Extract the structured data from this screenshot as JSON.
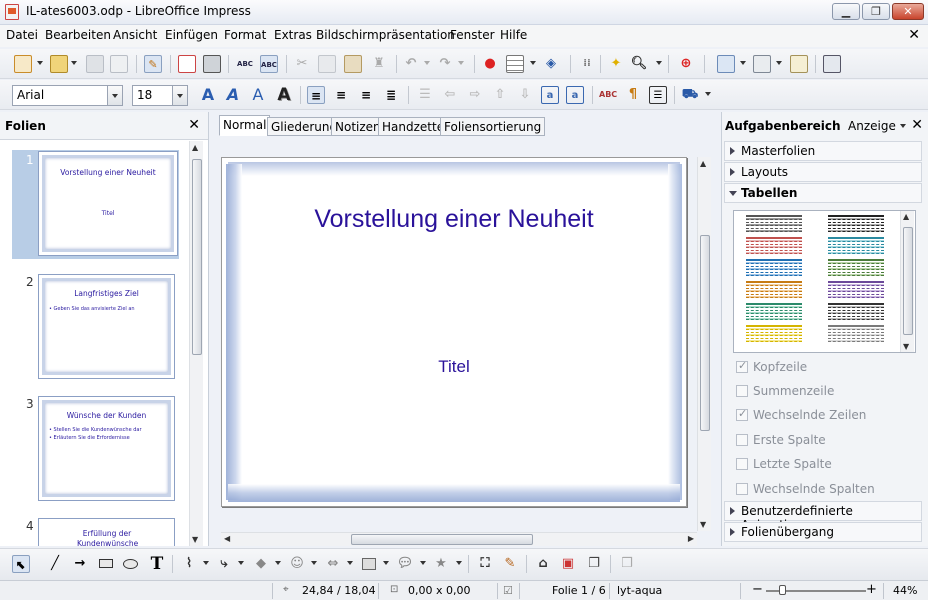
{
  "window": {
    "title": "IL-ates6003.odp - LibreOffice Impress"
  },
  "menu": [
    "Datei",
    "Bearbeiten",
    "Ansicht",
    "Einfügen",
    "Format",
    "Extras",
    "Bildschirmpräsentation",
    "Fenster",
    "Hilfe"
  ],
  "formatting": {
    "font_name": "Arial",
    "font_size": "18"
  },
  "slides_panel": {
    "title": "Folien",
    "slides": [
      {
        "number": "1",
        "title": "Vorstellung einer Neuheit",
        "subtitle": "Titel",
        "bullets": []
      },
      {
        "number": "2",
        "title": "Langfristiges Ziel",
        "subtitle": "",
        "bullets": [
          "Geben Sie das anvisierte Ziel an"
        ]
      },
      {
        "number": "3",
        "title": "Wünsche der Kunden",
        "subtitle": "",
        "bullets": [
          "Stellen Sie die Kundenwünsche dar",
          "Erläutern Sie die Erfordernisse"
        ]
      },
      {
        "number": "4",
        "title": "Erfüllung der Kundenwünsche",
        "subtitle": "",
        "bullets": []
      }
    ]
  },
  "view_tabs": [
    "Normal",
    "Gliederung",
    "Notizen",
    "Handzettel",
    "Foliensortierung"
  ],
  "slide": {
    "title": "Vorstellung einer Neuheit",
    "subtitle": "Titel"
  },
  "task_pane": {
    "title": "Aufgabenbereich",
    "view_menu": "Anzeige",
    "sections": [
      {
        "label": "Masterfolien",
        "open": false
      },
      {
        "label": "Layouts",
        "open": false
      },
      {
        "label": "Tabellen",
        "open": true
      }
    ],
    "table_options": [
      {
        "label": "Kopfzeile",
        "checked": true
      },
      {
        "label": "Summenzeile",
        "checked": false
      },
      {
        "label": "Wechselnde Zeilen",
        "checked": true
      },
      {
        "label": "Erste Spalte",
        "checked": false
      },
      {
        "label": "Letzte Spalte",
        "checked": false
      },
      {
        "label": "Wechselnde Spalten",
        "checked": false
      }
    ],
    "bottom_sections": [
      "Benutzerdefinierte Animation",
      "Folienübergang"
    ]
  },
  "status": {
    "position": "24,84 / 18,04",
    "size": "0,00 x 0,00",
    "slide": "Folie 1 / 6",
    "layout": "lyt-aqua",
    "zoom": "44%",
    "zoom_level": 0.44
  },
  "colors": {
    "slide_text": "#2a129a",
    "selection": "#b8cde6"
  }
}
